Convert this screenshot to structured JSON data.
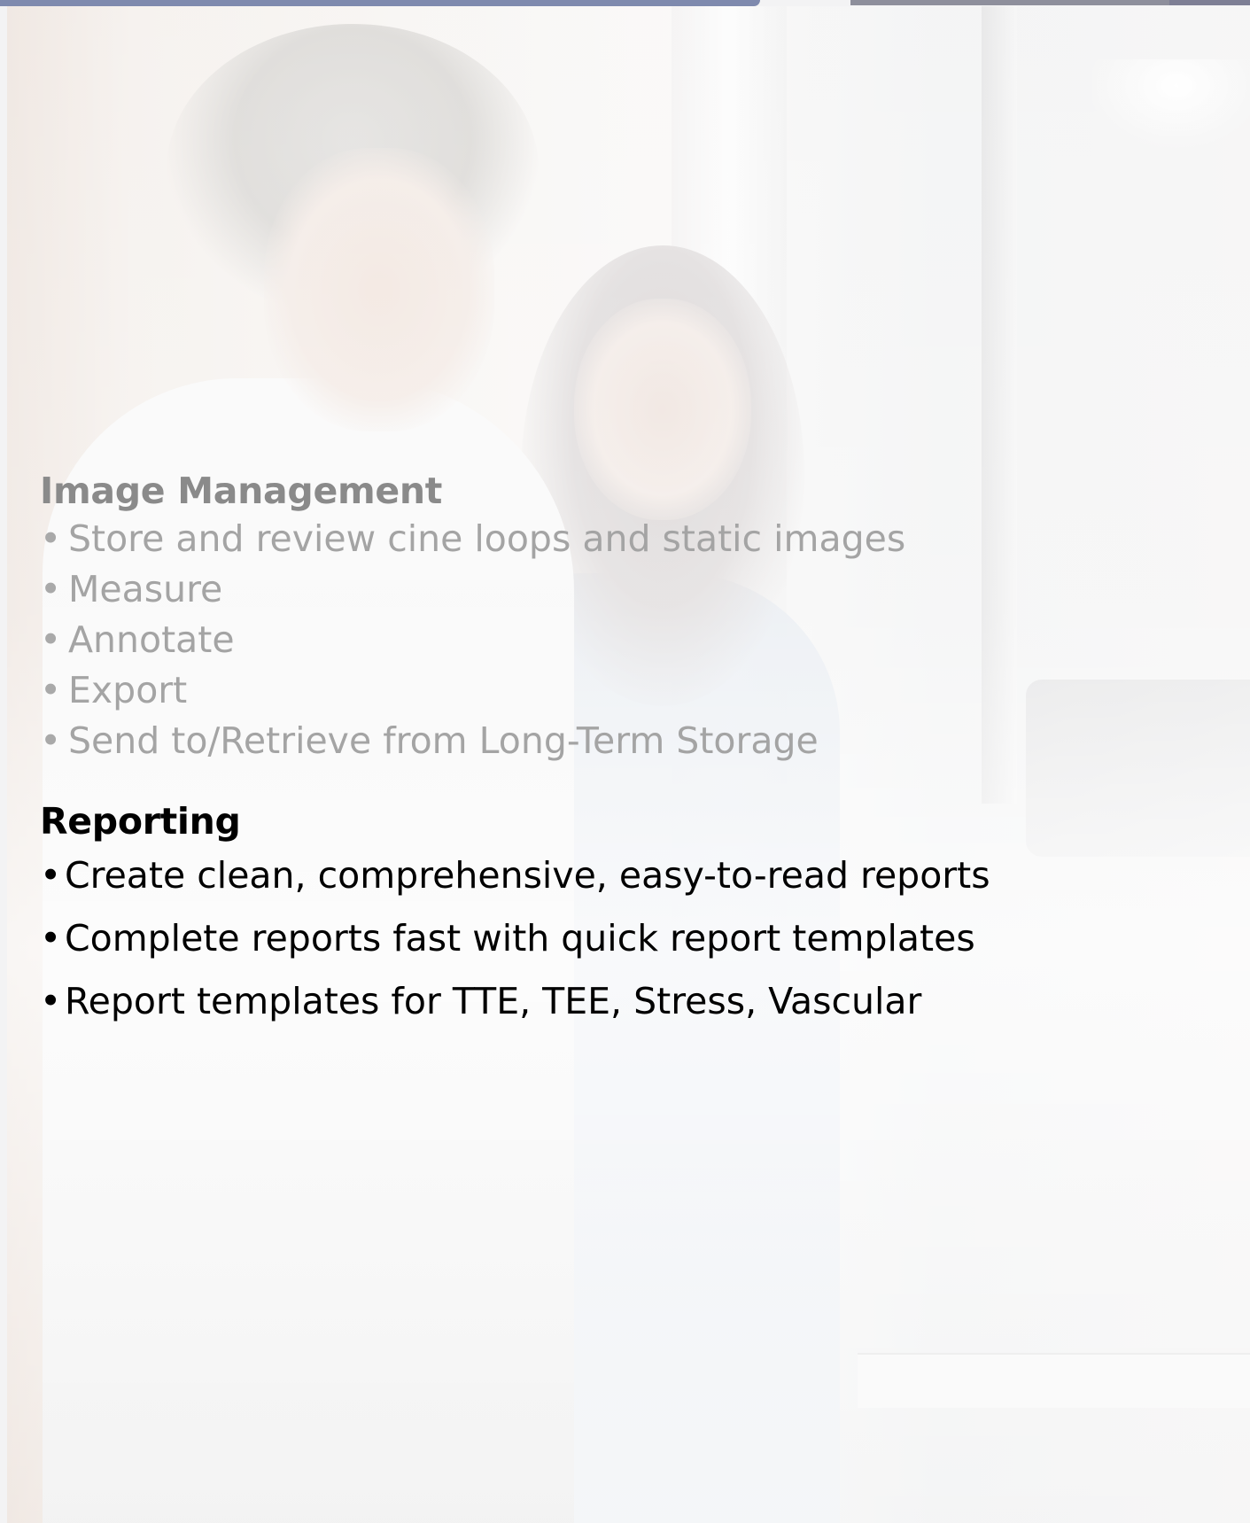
{
  "sections": [
    {
      "heading": "Image Management",
      "bullets": [
        "Store and review cine loops and static images",
        "Measure",
        "Annotate",
        "Export",
        "Send to/Retrieve from Long-Term Storage"
      ]
    },
    {
      "heading": "Reporting",
      "bullets": [
        "Create clean, comprehensive, easy-to-read reports",
        "Complete reports fast with quick report templates",
        "Report templates for TTE, TEE, Stress, Vascular"
      ]
    }
  ],
  "bullet_glyph": "•",
  "colors": {
    "top_bar": "#7f8aae",
    "faded_text": "#a4a4a4",
    "active_text": "#000000"
  }
}
